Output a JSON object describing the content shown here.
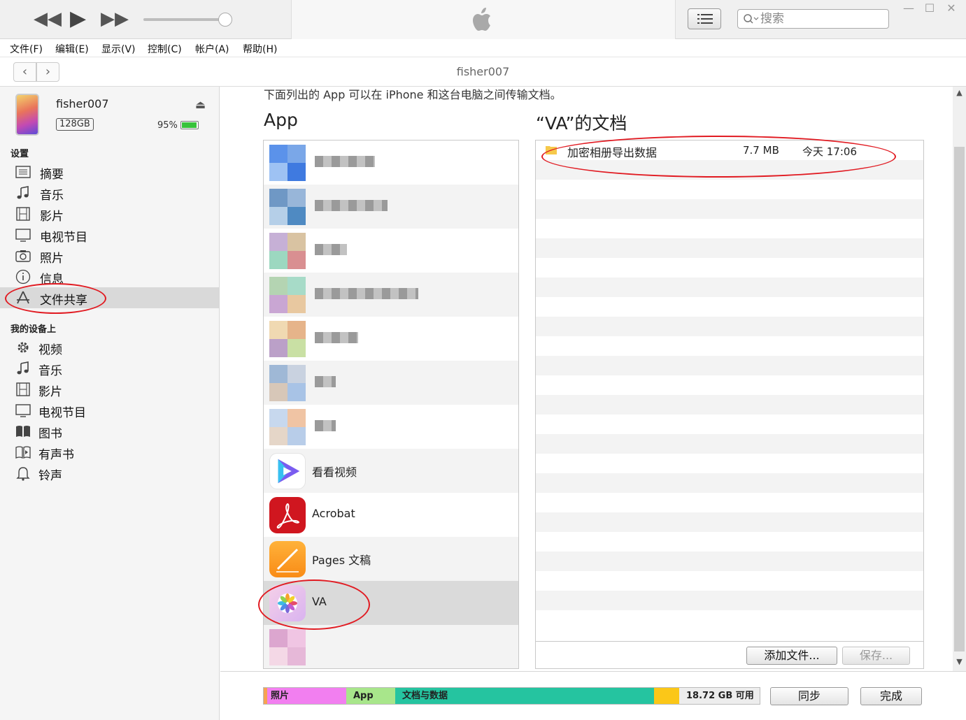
{
  "window": {
    "min_icon": "minimize-icon",
    "max_icon": "maximize-icon",
    "close_icon": "close-icon"
  },
  "player": {
    "prev_icon": "rewind-icon",
    "play_icon": "play-icon",
    "next_icon": "fast-forward-icon",
    "volume_level": 0.9
  },
  "search": {
    "placeholder": "搜索"
  },
  "menu": [
    "文件(F)",
    "编辑(E)",
    "显示(V)",
    "控制(C)",
    "帐户(A)",
    "帮助(H)"
  ],
  "nav": {
    "title": "fisher007",
    "back": "‹",
    "forward": "›"
  },
  "device": {
    "name": "fisher007",
    "capacity": "128GB",
    "battery": "95%",
    "battery_level": 0.95
  },
  "sidebar": {
    "settings_header": "设置",
    "settings": [
      {
        "label": "摘要",
        "icon": "summary-icon"
      },
      {
        "label": "音乐",
        "icon": "music-note-icon"
      },
      {
        "label": "影片",
        "icon": "film-icon"
      },
      {
        "label": "电视节目",
        "icon": "tv-icon"
      },
      {
        "label": "照片",
        "icon": "camera-icon"
      },
      {
        "label": "信息",
        "icon": "info-icon"
      },
      {
        "label": "文件共享",
        "icon": "app-store-icon",
        "selected": true
      }
    ],
    "device_header": "我的设备上",
    "device_items": [
      {
        "label": "视频",
        "icon": "gear-icon"
      },
      {
        "label": "音乐",
        "icon": "music-note-icon"
      },
      {
        "label": "影片",
        "icon": "film-icon"
      },
      {
        "label": "电视节目",
        "icon": "tv-icon"
      },
      {
        "label": "图书",
        "icon": "book-icon"
      },
      {
        "label": "有声书",
        "icon": "audiobook-icon"
      },
      {
        "label": "铃声",
        "icon": "bell-icon"
      }
    ]
  },
  "main": {
    "description": "下面列出的 App 可以在 iPhone 和这台电脑之间传输文档。",
    "apps_title": "App",
    "docs_title": "“VA”的文档",
    "apps": [
      {
        "label": "看看视频",
        "icon": "kankan-video-icon"
      },
      {
        "label": "Acrobat",
        "icon": "acrobat-icon"
      },
      {
        "label": "Pages 文稿",
        "icon": "pages-icon"
      },
      {
        "label": "VA",
        "icon": "photos-flower-icon",
        "selected": true
      }
    ],
    "documents": [
      {
        "name": "加密相册导出数据",
        "size": "7.7 MB",
        "date": "今天 17:06",
        "icon": "folder-icon"
      }
    ],
    "add_file": "添加文件...",
    "save": "保存..."
  },
  "storage": {
    "photos": "照片",
    "app": "App",
    "docs": "文档与数据",
    "free": "18.72 GB 可用",
    "colors": {
      "photos": "#f27ff0",
      "app": "#a8e68b",
      "docs": "#25c4a0",
      "other": "#fbc718",
      "free": "#ededed"
    }
  },
  "buttons": {
    "sync": "同步",
    "done": "完成"
  }
}
